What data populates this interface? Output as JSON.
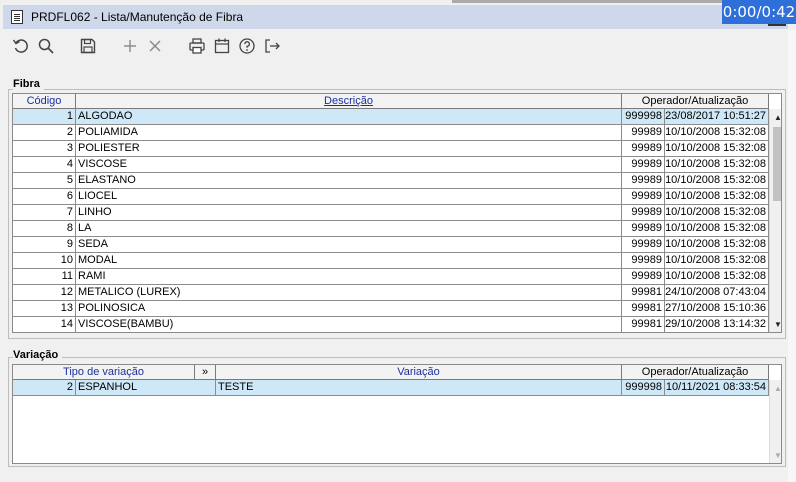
{
  "window": {
    "title": "PRDFL062 - Lista/Manutenção de Fibra",
    "timer": "0:00/0:42"
  },
  "toolbar": {
    "buttons": [
      {
        "name": "refresh-icon"
      },
      {
        "name": "search-icon"
      },
      {
        "name": "save-icon"
      },
      {
        "name": "add-icon"
      },
      {
        "name": "delete-icon"
      },
      {
        "name": "print-icon"
      },
      {
        "name": "calendar-icon"
      },
      {
        "name": "help-icon"
      },
      {
        "name": "exit-icon"
      }
    ]
  },
  "fibra": {
    "label": "Fibra",
    "columns": {
      "codigo": "Código",
      "descricao": "Descrição",
      "operador": "Operador/Atualização"
    },
    "rows": [
      {
        "codigo": "1",
        "descricao": "ALGODAO",
        "operador": "999998",
        "data": "23/08/2017 10:51:27"
      },
      {
        "codigo": "2",
        "descricao": "POLIAMIDA",
        "operador": "99989",
        "data": "10/10/2008 15:32:08"
      },
      {
        "codigo": "3",
        "descricao": "POLIESTER",
        "operador": "99989",
        "data": "10/10/2008 15:32:08"
      },
      {
        "codigo": "4",
        "descricao": "VISCOSE",
        "operador": "99989",
        "data": "10/10/2008 15:32:08"
      },
      {
        "codigo": "5",
        "descricao": "ELASTANO",
        "operador": "99989",
        "data": "10/10/2008 15:32:08"
      },
      {
        "codigo": "6",
        "descricao": "LIOCEL",
        "operador": "99989",
        "data": "10/10/2008 15:32:08"
      },
      {
        "codigo": "7",
        "descricao": "LINHO",
        "operador": "99989",
        "data": "10/10/2008 15:32:08"
      },
      {
        "codigo": "8",
        "descricao": "LA",
        "operador": "99989",
        "data": "10/10/2008 15:32:08"
      },
      {
        "codigo": "9",
        "descricao": "SEDA",
        "operador": "99989",
        "data": "10/10/2008 15:32:08"
      },
      {
        "codigo": "10",
        "descricao": "MODAL",
        "operador": "99989",
        "data": "10/10/2008 15:32:08"
      },
      {
        "codigo": "11",
        "descricao": "RAMI",
        "operador": "99989",
        "data": "10/10/2008 15:32:08"
      },
      {
        "codigo": "12",
        "descricao": "METALICO (LUREX)",
        "operador": "99981",
        "data": "24/10/2008 07:43:04"
      },
      {
        "codigo": "13",
        "descricao": "POLINOSICA",
        "operador": "99981",
        "data": "27/10/2008 15:10:36"
      },
      {
        "codigo": "14",
        "descricao": "VISCOSE(BAMBU)",
        "operador": "99981",
        "data": "29/10/2008 13:14:32"
      }
    ]
  },
  "variacao": {
    "label": "Variação",
    "columns": {
      "tipo": "Tipo de variação",
      "expand": "»",
      "variacao": "Variação",
      "operador": "Operador/Atualização"
    },
    "rows": [
      {
        "codigo": "2",
        "tipo": "ESPANHOL",
        "variacao": "TESTE",
        "operador": "999998",
        "data": "10/11/2021 08:33:54"
      }
    ]
  }
}
